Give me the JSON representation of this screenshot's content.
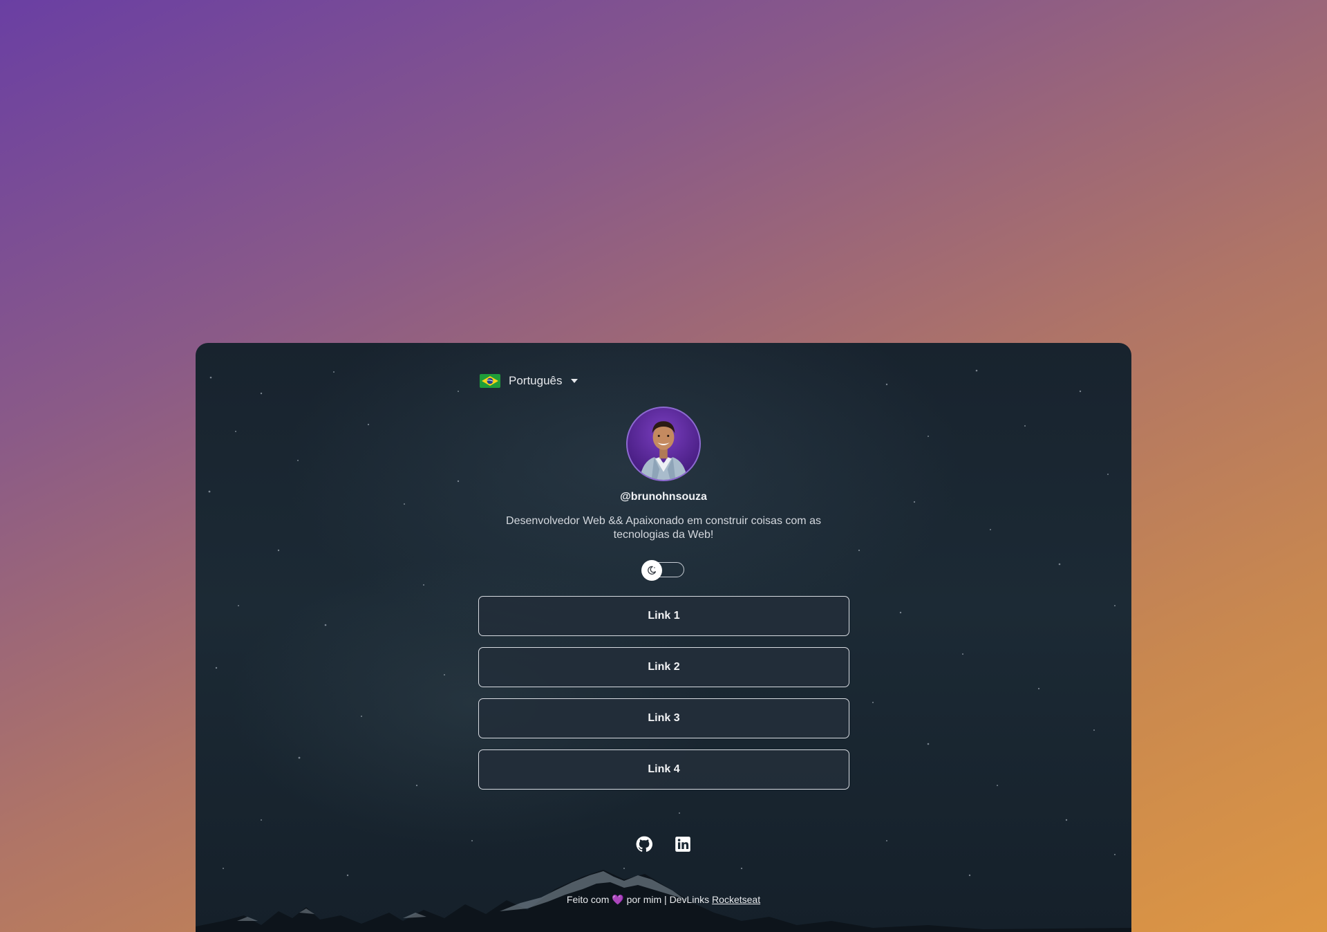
{
  "language": {
    "flag": "brazil-flag-icon",
    "label": "Português"
  },
  "profile": {
    "avatar_alt": "avatar",
    "handle": "@brunohnsouza",
    "bio": "Desenvolvedor Web && Apaixonado em construir coisas com as tecnologias da Web!"
  },
  "theme_toggle": {
    "icon": "moon-icon",
    "state": "dark"
  },
  "links": [
    {
      "label": "Link 1"
    },
    {
      "label": "Link 2"
    },
    {
      "label": "Link 3"
    },
    {
      "label": "Link 4"
    }
  ],
  "social": [
    {
      "icon": "github-icon"
    },
    {
      "icon": "linkedin-icon"
    }
  ],
  "footer": {
    "prefix": "Feito com",
    "heart": "💜",
    "middle": "por mim | DevLinks",
    "link_label": "Rocketseat"
  },
  "colors": {
    "card_bg": "#1c2a35",
    "button_bg": "#232e39",
    "accent": "#8b4fd6"
  }
}
